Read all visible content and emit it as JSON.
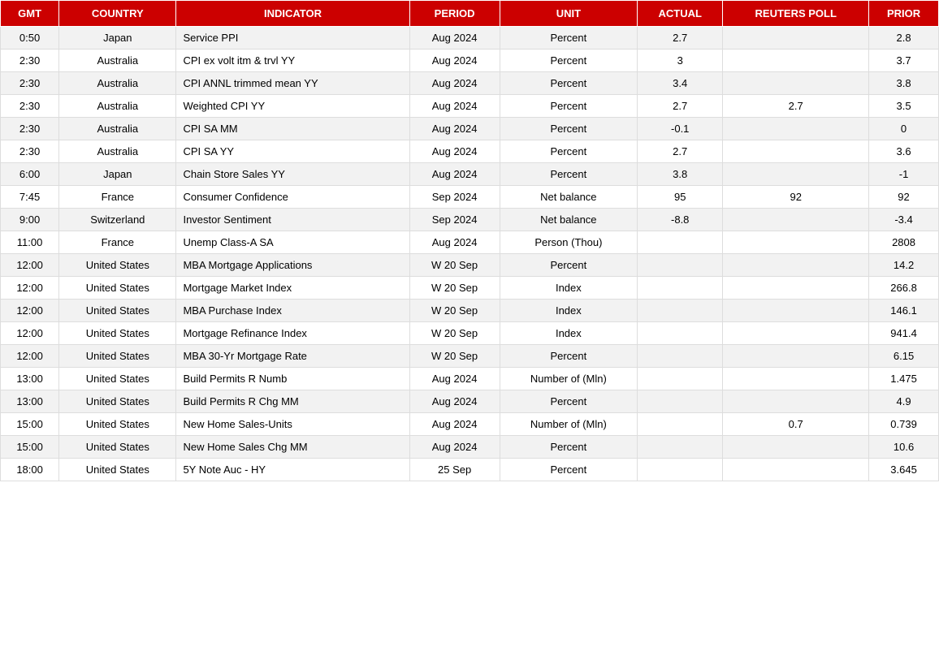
{
  "headers": [
    "GMT",
    "COUNTRY",
    "INDICATOR",
    "PERIOD",
    "UNIT",
    "ACTUAL",
    "REUTERS POLL",
    "PRIOR"
  ],
  "rows": [
    {
      "gmt": "0:50",
      "country": "Japan",
      "indicator": "Service PPI",
      "period": "Aug 2024",
      "unit": "Percent",
      "actual": "2.7",
      "poll": "",
      "prior": "2.8",
      "shaded": false
    },
    {
      "gmt": "2:30",
      "country": "Australia",
      "indicator": "CPI ex volt itm & trvl YY",
      "period": "Aug 2024",
      "unit": "Percent",
      "actual": "3",
      "poll": "",
      "prior": "3.7",
      "shaded": true
    },
    {
      "gmt": "2:30",
      "country": "Australia",
      "indicator": "CPI ANNL trimmed mean YY",
      "period": "Aug 2024",
      "unit": "Percent",
      "actual": "3.4",
      "poll": "",
      "prior": "3.8",
      "shaded": false
    },
    {
      "gmt": "2:30",
      "country": "Australia",
      "indicator": "Weighted CPI YY",
      "period": "Aug 2024",
      "unit": "Percent",
      "actual": "2.7",
      "poll": "2.7",
      "prior": "3.5",
      "shaded": true
    },
    {
      "gmt": "2:30",
      "country": "Australia",
      "indicator": "CPI SA MM",
      "period": "Aug 2024",
      "unit": "Percent",
      "actual": "-0.1",
      "poll": "",
      "prior": "0",
      "shaded": false
    },
    {
      "gmt": "2:30",
      "country": "Australia",
      "indicator": "CPI SA YY",
      "period": "Aug 2024",
      "unit": "Percent",
      "actual": "2.7",
      "poll": "",
      "prior": "3.6",
      "shaded": true
    },
    {
      "gmt": "6:00",
      "country": "Japan",
      "indicator": "Chain Store Sales YY",
      "period": "Aug 2024",
      "unit": "Percent",
      "actual": "3.8",
      "poll": "",
      "prior": "-1",
      "shaded": false
    },
    {
      "gmt": "7:45",
      "country": "France",
      "indicator": "Consumer Confidence",
      "period": "Sep 2024",
      "unit": "Net balance",
      "actual": "95",
      "poll": "92",
      "prior": "92",
      "shaded": true
    },
    {
      "gmt": "9:00",
      "country": "Switzerland",
      "indicator": "Investor Sentiment",
      "period": "Sep 2024",
      "unit": "Net balance",
      "actual": "-8.8",
      "poll": "",
      "prior": "-3.4",
      "shaded": false
    },
    {
      "gmt": "11:00",
      "country": "France",
      "indicator": "Unemp Class-A SA",
      "period": "Aug 2024",
      "unit": "Person (Thou)",
      "actual": "",
      "poll": "",
      "prior": "2808",
      "shaded": true
    },
    {
      "gmt": "12:00",
      "country": "United States",
      "indicator": "MBA Mortgage Applications",
      "period": "W 20 Sep",
      "unit": "Percent",
      "actual": "",
      "poll": "",
      "prior": "14.2",
      "shaded": false
    },
    {
      "gmt": "12:00",
      "country": "United States",
      "indicator": "Mortgage Market Index",
      "period": "W 20 Sep",
      "unit": "Index",
      "actual": "",
      "poll": "",
      "prior": "266.8",
      "shaded": true
    },
    {
      "gmt": "12:00",
      "country": "United States",
      "indicator": "MBA Purchase Index",
      "period": "W 20 Sep",
      "unit": "Index",
      "actual": "",
      "poll": "",
      "prior": "146.1",
      "shaded": false
    },
    {
      "gmt": "12:00",
      "country": "United States",
      "indicator": "Mortgage Refinance Index",
      "period": "W 20 Sep",
      "unit": "Index",
      "actual": "",
      "poll": "",
      "prior": "941.4",
      "shaded": true
    },
    {
      "gmt": "12:00",
      "country": "United States",
      "indicator": "MBA 30-Yr Mortgage Rate",
      "period": "W 20 Sep",
      "unit": "Percent",
      "actual": "",
      "poll": "",
      "prior": "6.15",
      "shaded": false
    },
    {
      "gmt": "13:00",
      "country": "United States",
      "indicator": "Build Permits R Numb",
      "period": "Aug 2024",
      "unit": "Number of (Mln)",
      "actual": "",
      "poll": "",
      "prior": "1.475",
      "shaded": true
    },
    {
      "gmt": "13:00",
      "country": "United States",
      "indicator": "Build Permits R Chg MM",
      "period": "Aug 2024",
      "unit": "Percent",
      "actual": "",
      "poll": "",
      "prior": "4.9",
      "shaded": false
    },
    {
      "gmt": "15:00",
      "country": "United States",
      "indicator": "New Home Sales-Units",
      "period": "Aug 2024",
      "unit": "Number of (Mln)",
      "actual": "",
      "poll": "0.7",
      "prior": "0.739",
      "shaded": true
    },
    {
      "gmt": "15:00",
      "country": "United States",
      "indicator": "New Home Sales Chg MM",
      "period": "Aug 2024",
      "unit": "Percent",
      "actual": "",
      "poll": "",
      "prior": "10.6",
      "shaded": false
    },
    {
      "gmt": "18:00",
      "country": "United States",
      "indicator": "5Y Note Auc - HY",
      "period": "25 Sep",
      "unit": "Percent",
      "actual": "",
      "poll": "",
      "prior": "3.645",
      "shaded": true
    }
  ]
}
